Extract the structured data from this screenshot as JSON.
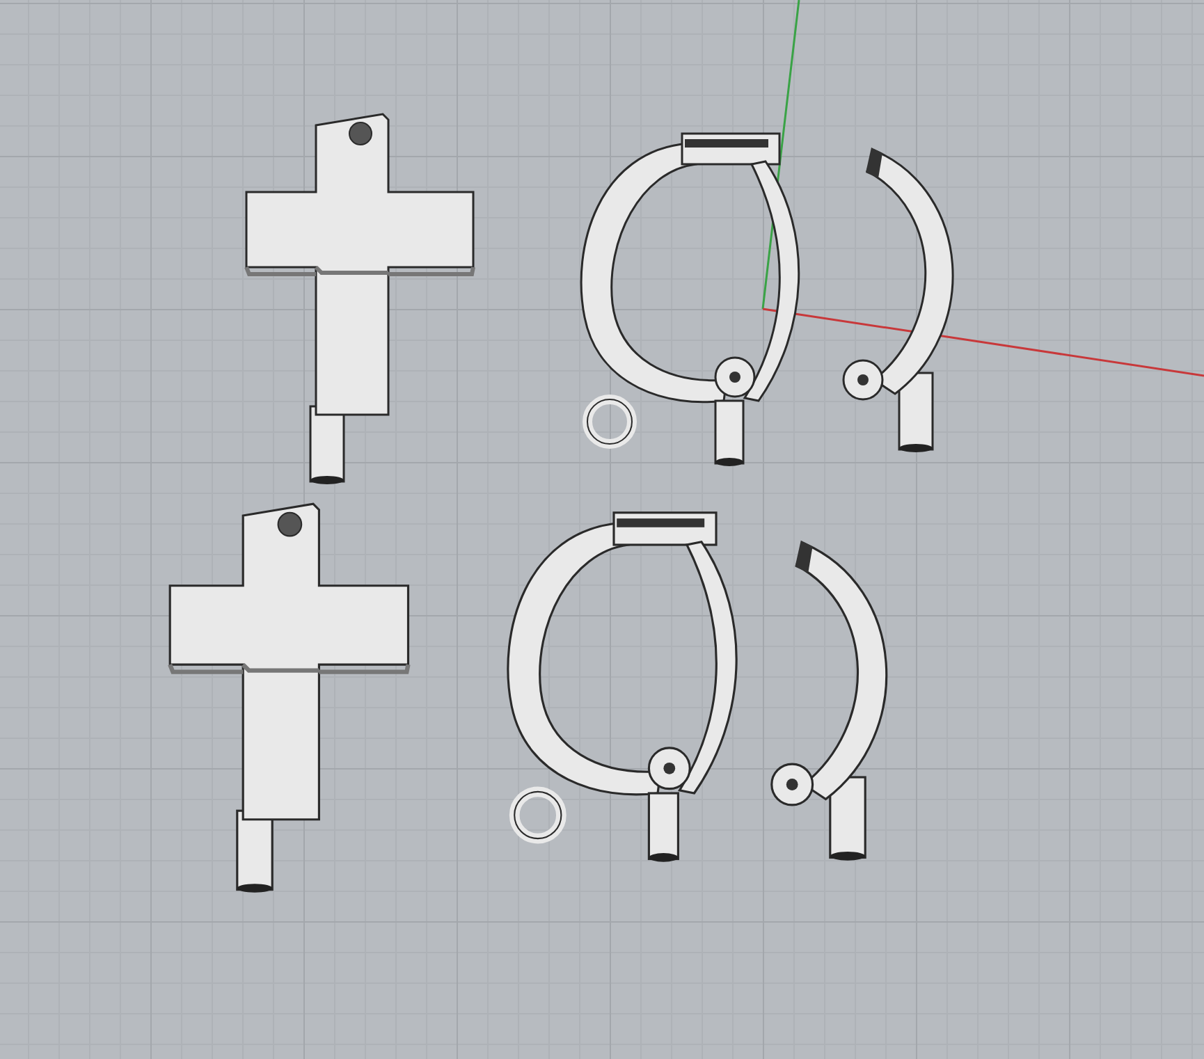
{
  "viewport": {
    "axes": [
      {
        "kind": "y"
      },
      {
        "kind": "x"
      }
    ],
    "rows": [
      {
        "items": [
          {
            "kind": "cross"
          },
          {
            "kind": "hoop"
          },
          {
            "kind": "latch"
          }
        ]
      },
      {
        "items": [
          {
            "kind": "cross"
          },
          {
            "kind": "hoop"
          },
          {
            "kind": "latch"
          }
        ]
      }
    ]
  }
}
